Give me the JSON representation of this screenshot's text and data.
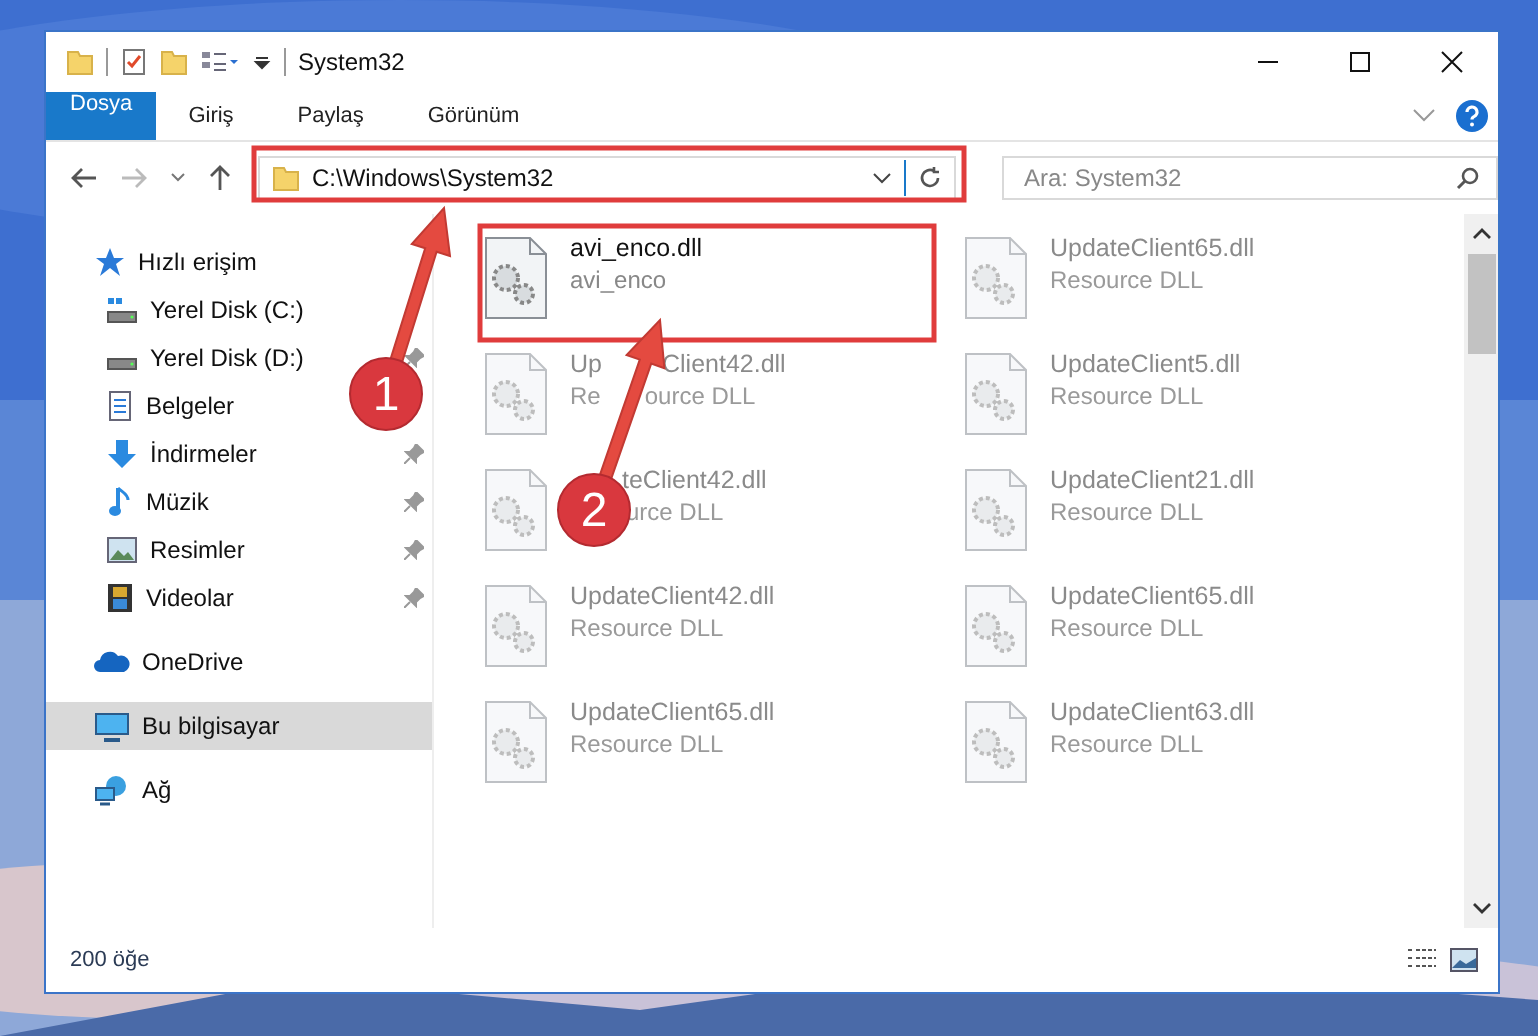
{
  "window": {
    "title": "System32"
  },
  "ribbon": {
    "tabs": [
      {
        "label": "Dosya",
        "kind": "file"
      },
      {
        "label": "Giriş",
        "kind": "tab"
      },
      {
        "label": "Paylaş",
        "kind": "tab"
      },
      {
        "label": "Görünüm",
        "kind": "tab"
      }
    ]
  },
  "address": {
    "path": "C:\\Windows\\System32",
    "search_placeholder": "Ara: System32"
  },
  "sidebar": {
    "items": [
      {
        "label": "Hızlı erişim",
        "selected": false,
        "children": [
          {
            "label": "Yerel Disk (C:)",
            "pinned": false,
            "selected": false
          },
          {
            "label": "Yerel Disk (D:)",
            "pinned": true,
            "selected": false
          },
          {
            "label": "Belgeler",
            "pinned": false,
            "selected": false
          },
          {
            "label": "İndirmeler",
            "pinned": true,
            "selected": false
          },
          {
            "label": "Müzik",
            "pinned": true,
            "selected": false
          },
          {
            "label": "Resimler",
            "pinned": true,
            "selected": false
          },
          {
            "label": "Videolar",
            "pinned": true,
            "selected": false
          }
        ]
      },
      {
        "label": "OneDrive",
        "selected": false
      },
      {
        "label": "Bu bilgisayar",
        "selected": true
      },
      {
        "label": "Ağ",
        "selected": false
      }
    ]
  },
  "files": [
    {
      "name": "avi_enco.dll",
      "type": "avi_enco",
      "dimmed": false
    },
    {
      "name": "UpdateClient65.dll",
      "type": "Resource DLL",
      "dimmed": true
    },
    {
      "kind": "split",
      "name_parts": [
        "Up",
        "Client42.dll"
      ],
      "type_parts": [
        "Re",
        "ource DLL"
      ],
      "dimmed": true
    },
    {
      "name": "UpdateClient5.dll",
      "type": "Resource DLL",
      "dimmed": true
    },
    {
      "kind": "tail",
      "name_parts": [
        "teClient42.dll"
      ],
      "type_parts": [
        "urce DLL"
      ],
      "dimmed": true
    },
    {
      "name": "UpdateClient21.dll",
      "type": "Resource DLL",
      "dimmed": true
    },
    {
      "name": "UpdateClient42.dll",
      "type": "Resource DLL",
      "dimmed": true
    },
    {
      "name": "UpdateClient65.dll",
      "type": "Resource DLL",
      "dimmed": true
    },
    {
      "name": "UpdateClient65.dll",
      "type": "Resource DLL",
      "dimmed": true
    },
    {
      "name": "UpdateClient63.dll",
      "type": "Resource DLL",
      "dimmed": true
    }
  ],
  "status_bar": {
    "count": "200 öğe"
  },
  "annotations": [
    {
      "label": "1"
    },
    {
      "label": "2"
    }
  ]
}
